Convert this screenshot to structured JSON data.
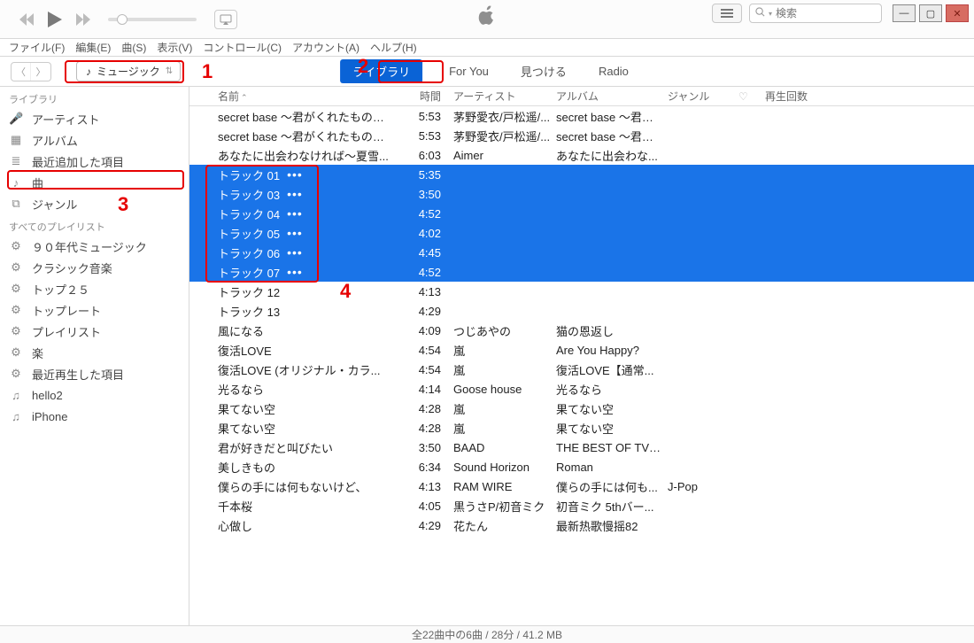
{
  "player": {
    "search_placeholder": "検索"
  },
  "menu": [
    "ファイル(F)",
    "編集(E)",
    "曲(S)",
    "表示(V)",
    "コントロール(C)",
    "アカウント(A)",
    "ヘルプ(H)"
  ],
  "media_selector": "ミュージック",
  "top_tabs": {
    "library": "ライブラリ",
    "for_you": "For You",
    "browse": "見つける",
    "radio": "Radio"
  },
  "sidebar": {
    "library_label": "ライブラリ",
    "items": [
      {
        "icon": "mic",
        "label": "アーティスト"
      },
      {
        "icon": "grid",
        "label": "アルバム"
      },
      {
        "icon": "list",
        "label": "最近追加した項目"
      },
      {
        "icon": "note",
        "label": "曲",
        "selected": true
      },
      {
        "icon": "tags",
        "label": "ジャンル"
      }
    ],
    "playlists_label": "すべてのプレイリスト",
    "playlists": [
      {
        "icon": "gear",
        "label": "９０年代ミュージック"
      },
      {
        "icon": "gear",
        "label": "クラシック音楽"
      },
      {
        "icon": "gear",
        "label": "トップ２５"
      },
      {
        "icon": "gear",
        "label": "トップレート"
      },
      {
        "icon": "gear",
        "label": "プレイリスト"
      },
      {
        "icon": "gear",
        "label": "楽"
      },
      {
        "icon": "gear",
        "label": "最近再生した項目"
      },
      {
        "icon": "plist",
        "label": "hello2"
      },
      {
        "icon": "plist",
        "label": "iPhone"
      }
    ]
  },
  "columns": {
    "name": "名前",
    "time": "時間",
    "artist": "アーティスト",
    "album": "アルバム",
    "genre": "ジャンル",
    "heart": "♡",
    "plays": "再生回数"
  },
  "songs": [
    {
      "name": "secret base ～君がくれたもの～ (...",
      "time": "5:53",
      "artist": "茅野愛衣/戸松遥/...",
      "album": "secret base ～君が..."
    },
    {
      "name": "secret base ～君がくれたもの～ (...",
      "time": "5:53",
      "artist": "茅野愛衣/戸松遥/...",
      "album": "secret base ～君が..."
    },
    {
      "name": "あなたに出会わなければ～夏雪...",
      "time": "6:03",
      "artist": "Aimer",
      "album": "あなたに出会わな..."
    },
    {
      "name": "トラック 01",
      "time": "5:35",
      "selected": true
    },
    {
      "name": "トラック 03",
      "time": "3:50",
      "selected": true
    },
    {
      "name": "トラック 04",
      "time": "4:52",
      "selected": true
    },
    {
      "name": "トラック 05",
      "time": "4:02",
      "selected": true
    },
    {
      "name": "トラック 06",
      "time": "4:45",
      "selected": true
    },
    {
      "name": "トラック 07",
      "time": "4:52",
      "selected": true
    },
    {
      "name": "トラック 12",
      "time": "4:13"
    },
    {
      "name": "トラック 13",
      "time": "4:29"
    },
    {
      "name": "風になる",
      "time": "4:09",
      "artist": "つじあやの",
      "album": "猫の恩返し"
    },
    {
      "name": "復活LOVE",
      "time": "4:54",
      "artist": "嵐",
      "album": "Are You Happy?"
    },
    {
      "name": "復活LOVE (オリジナル・カラ...",
      "time": "4:54",
      "artist": "嵐",
      "album": "復活LOVE【通常..."
    },
    {
      "name": "光るなら",
      "time": "4:14",
      "artist": "Goose house",
      "album": "光るなら"
    },
    {
      "name": "果てない空",
      "time": "4:28",
      "artist": "嵐",
      "album": "果てない空"
    },
    {
      "name": "果てない空",
      "time": "4:28",
      "artist": "嵐",
      "album": "果てない空"
    },
    {
      "name": "君が好きだと叫びたい",
      "time": "3:50",
      "artist": "BAAD",
      "album": "THE BEST OF TV A..."
    },
    {
      "name": "美しきもの",
      "time": "6:34",
      "artist": "Sound Horizon",
      "album": "Roman"
    },
    {
      "name": "僕らの手には何もないけど、",
      "time": "4:13",
      "artist": "RAM WIRE",
      "album": "僕らの手には何も...",
      "genre": "J-Pop"
    },
    {
      "name": "千本桜",
      "time": "4:05",
      "artist": "黒うさP/初音ミク",
      "album": "初音ミク 5thバー..."
    },
    {
      "name": "心做し",
      "time": "4:29",
      "artist": "花たん",
      "album": "最新热歌慢摇82"
    }
  ],
  "status": "全22曲中の6曲 / 28分 / 41.2 MB",
  "annotations": {
    "a1": "1",
    "a2": "2",
    "a3": "3",
    "a4": "4"
  }
}
